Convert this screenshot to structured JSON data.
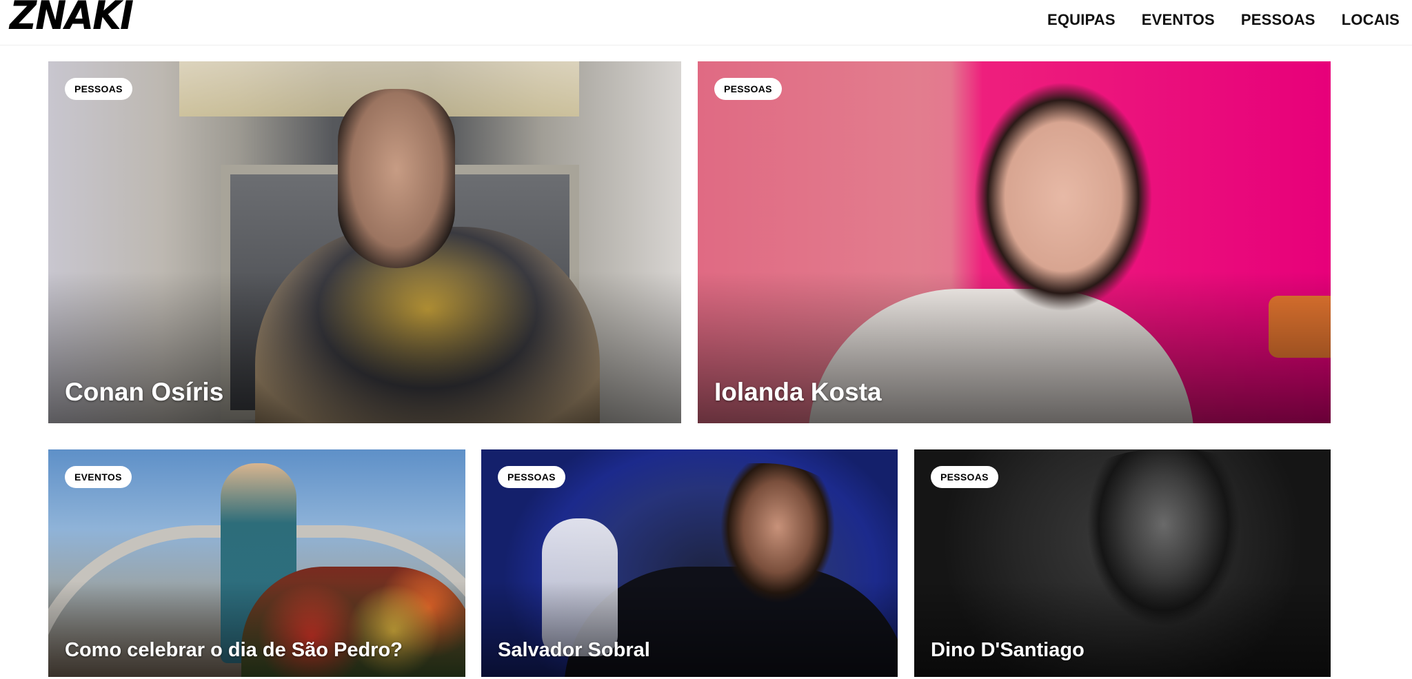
{
  "site": {
    "logo": "ZNAKI"
  },
  "nav": {
    "items": [
      "EQUIPAS",
      "EVENTOS",
      "PESSOAS",
      "LOCAIS"
    ]
  },
  "cards": [
    {
      "category": "PESSOAS",
      "title": "Conan Osíris"
    },
    {
      "category": "PESSOAS",
      "title": "Iolanda Kosta"
    },
    {
      "category": "EVENTOS",
      "title": "Como celebrar o dia de São Pedro?"
    },
    {
      "category": "PESSOAS",
      "title": "Salvador Sobral"
    },
    {
      "category": "PESSOAS",
      "title": "Dino D'Santiago"
    }
  ],
  "colors": {
    "badge_bg": "#ffffff",
    "title_text": "#ffffff",
    "logo": "#000000"
  }
}
